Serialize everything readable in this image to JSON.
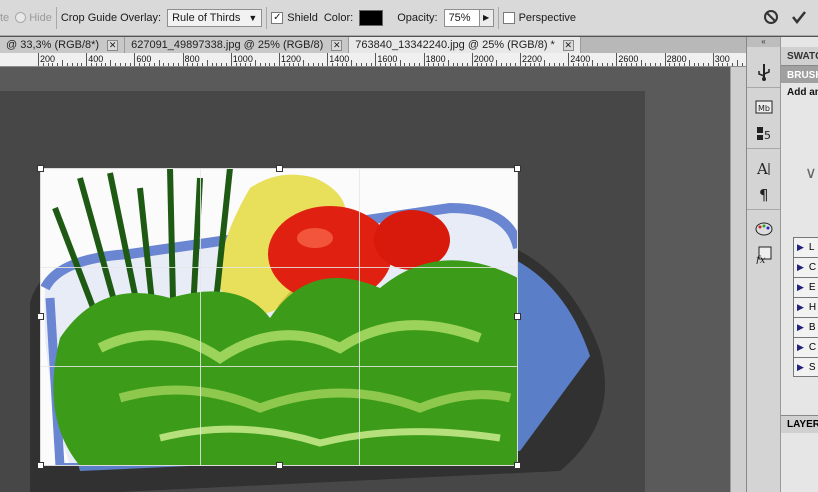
{
  "options_bar": {
    "delete_label_partial": "te",
    "hide_label": "Hide",
    "crop_guide_label": "Crop Guide Overlay:",
    "crop_guide_value": "Rule of Thirds",
    "shield_label": "Shield",
    "shield_checked": true,
    "color_label": "Color:",
    "shield_color": "#000000",
    "opacity_label": "Opacity:",
    "opacity_value": "75%",
    "perspective_label": "Perspective",
    "perspective_checked": false
  },
  "tabs": [
    {
      "label": "@ 33,3% (RGB/8*)",
      "active": false
    },
    {
      "label": "627091_49897338.jpg @ 25% (RGB/8)",
      "active": false
    },
    {
      "label": "763840_13342240.jpg @ 25% (RGB/8) *",
      "active": true
    }
  ],
  "ruler_labels": [
    "200",
    "400",
    "600",
    "800",
    "1000",
    "1200",
    "1400",
    "1600",
    "1800",
    "2000",
    "2200",
    "2400",
    "2600",
    "2800",
    "300"
  ],
  "right_panel": {
    "swatches_tab": "SWATCH",
    "brush_tab": "BRUSH",
    "add_label": "Add an",
    "list_items": [
      "L",
      "C",
      "E",
      "H",
      "B",
      "C",
      "S"
    ],
    "layers_tab": "LAYERS"
  },
  "dock_icons": [
    "usb-icon",
    "mini-bridge-icon",
    "clone-source-icon",
    "character-icon",
    "paragraph-icon",
    "palette-icon",
    "fx-icon"
  ],
  "colors": {
    "workspace": "#5a5a5a",
    "canvas_bg": "#474747",
    "bowl_rim": "#6a86d2",
    "tomato": "#e02010",
    "pepper": "#e8df5a",
    "lettuce": "#3c9c1a"
  }
}
